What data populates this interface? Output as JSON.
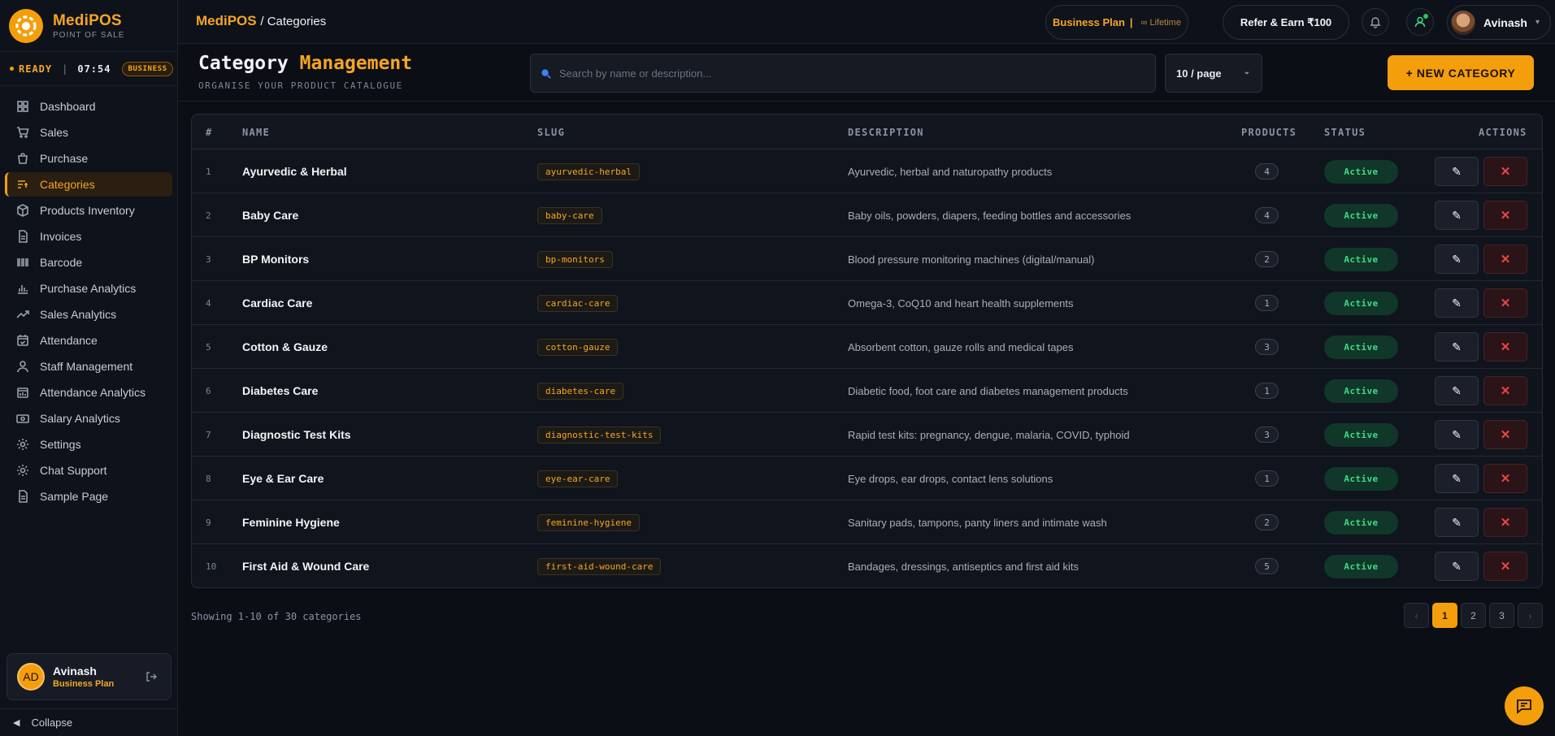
{
  "brand": {
    "name": "MediPOS",
    "subtitle": "POINT OF SALE"
  },
  "status": {
    "state": "READY",
    "time": "07:54",
    "badge": "BUSINESS"
  },
  "nav": [
    {
      "label": "Dashboard",
      "icon": "grid-icon",
      "active": false
    },
    {
      "label": "Sales",
      "icon": "cart-icon",
      "active": false
    },
    {
      "label": "Purchase",
      "icon": "bag-icon",
      "active": false
    },
    {
      "label": "Categories",
      "icon": "list-filter-icon",
      "active": true
    },
    {
      "label": "Products Inventory",
      "icon": "box-icon",
      "active": false
    },
    {
      "label": "Invoices",
      "icon": "file-icon",
      "active": false
    },
    {
      "label": "Barcode",
      "icon": "barcode-icon",
      "active": false
    },
    {
      "label": "Purchase Analytics",
      "icon": "bar-chart-icon",
      "active": false
    },
    {
      "label": "Sales Analytics",
      "icon": "trend-icon",
      "active": false
    },
    {
      "label": "Attendance",
      "icon": "calendar-check-icon",
      "active": false
    },
    {
      "label": "Staff Management",
      "icon": "user-icon",
      "active": false
    },
    {
      "label": "Attendance Analytics",
      "icon": "calendar-chart-icon",
      "active": false
    },
    {
      "label": "Salary Analytics",
      "icon": "cash-icon",
      "active": false
    },
    {
      "label": "Settings",
      "icon": "gear-icon",
      "active": false
    },
    {
      "label": "Chat Support",
      "icon": "gear-icon",
      "active": false
    },
    {
      "label": "Sample Page",
      "icon": "file-icon",
      "active": false
    }
  ],
  "user_card": {
    "initials": "AD",
    "name": "Avinash",
    "plan": "Business Plan"
  },
  "collapse_label": "Collapse",
  "topbar": {
    "breadcrumb_app": "MediPOS",
    "breadcrumb_page": "/ Categories",
    "plan_label": "Business Plan",
    "plan_sep": "|",
    "plan_term": "∞ Lifetime",
    "refer_label": "Refer & Earn ₹100",
    "user_name": "Avinash"
  },
  "header": {
    "title_word1": "Category",
    "title_word2": "Management",
    "subtitle": "ORGANISE YOUR PRODUCT CATALOGUE",
    "search_placeholder": "Search by name or description...",
    "per_page": "10 / page",
    "new_button": "+ NEW CATEGORY"
  },
  "table": {
    "columns": {
      "num": "#",
      "name": "NAME",
      "slug": "SLUG",
      "description": "DESCRIPTION",
      "products": "PRODUCTS",
      "status": "STATUS",
      "actions": "ACTIONS"
    },
    "rows": [
      {
        "num": "1",
        "name": "Ayurvedic & Herbal",
        "slug": "ayurvedic-herbal",
        "description": "Ayurvedic, herbal and naturopathy products",
        "products": "4",
        "status": "Active"
      },
      {
        "num": "2",
        "name": "Baby Care",
        "slug": "baby-care",
        "description": "Baby oils, powders, diapers, feeding bottles and accessories",
        "products": "4",
        "status": "Active"
      },
      {
        "num": "3",
        "name": "BP Monitors",
        "slug": "bp-monitors",
        "description": "Blood pressure monitoring machines (digital/manual)",
        "products": "2",
        "status": "Active"
      },
      {
        "num": "4",
        "name": "Cardiac Care",
        "slug": "cardiac-care",
        "description": "Omega-3, CoQ10 and heart health supplements",
        "products": "1",
        "status": "Active"
      },
      {
        "num": "5",
        "name": "Cotton & Gauze",
        "slug": "cotton-gauze",
        "description": "Absorbent cotton, gauze rolls and medical tapes",
        "products": "3",
        "status": "Active"
      },
      {
        "num": "6",
        "name": "Diabetes Care",
        "slug": "diabetes-care",
        "description": "Diabetic food, foot care and diabetes management products",
        "products": "1",
        "status": "Active"
      },
      {
        "num": "7",
        "name": "Diagnostic Test Kits",
        "slug": "diagnostic-test-kits",
        "description": "Rapid test kits: pregnancy, dengue, malaria, COVID, typhoid",
        "products": "3",
        "status": "Active"
      },
      {
        "num": "8",
        "name": "Eye & Ear Care",
        "slug": "eye-ear-care",
        "description": "Eye drops, ear drops, contact lens solutions",
        "products": "1",
        "status": "Active"
      },
      {
        "num": "9",
        "name": "Feminine Hygiene",
        "slug": "feminine-hygiene",
        "description": "Sanitary pads, tampons, panty liners and intimate wash",
        "products": "2",
        "status": "Active"
      },
      {
        "num": "10",
        "name": "First Aid & Wound Care",
        "slug": "first-aid-wound-care",
        "description": "Bandages, dressings, antiseptics and first aid kits",
        "products": "5",
        "status": "Active"
      }
    ]
  },
  "footer": {
    "showing": "Showing 1-10 of 30 categories",
    "prev": "‹",
    "pages": [
      "1",
      "2",
      "3"
    ],
    "current_page": "1",
    "next": "›"
  },
  "colors": {
    "accent": "#f59e0b",
    "active_status": "#3ddc84",
    "danger": "#ef4444",
    "background": "#0b0e15"
  }
}
